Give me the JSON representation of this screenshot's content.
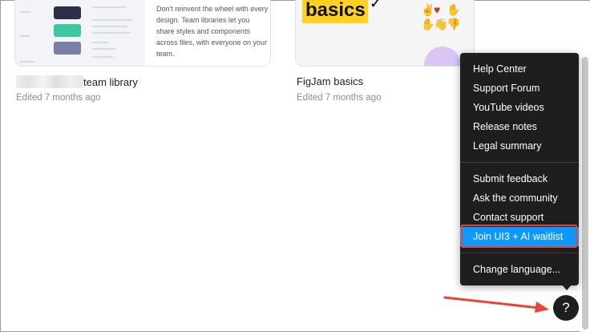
{
  "files": [
    {
      "name_suffix": "team library",
      "edited": "Edited 7 months ago",
      "thumb_text": "Don't reinvent the wheel with every design. Team libraries let you share styles and components across files, with everyone on your team."
    },
    {
      "name": "FigJam basics",
      "edited": "Edited 7 months ago",
      "banner": "basics"
    }
  ],
  "help_menu": {
    "group1": [
      "Help Center",
      "Support Forum",
      "YouTube videos",
      "Release notes",
      "Legal summary"
    ],
    "group2": [
      "Submit feedback",
      "Ask the community",
      "Contact support",
      "Join UI3 + AI waitlist"
    ],
    "group3": [
      "Change language..."
    ],
    "highlighted_item": "Join UI3 + AI waitlist"
  },
  "help_button": {
    "label": "?"
  },
  "colors": {
    "menu_bg": "#1e1e1e",
    "highlight": "#0d99ff",
    "annotation": "#e8443a"
  }
}
